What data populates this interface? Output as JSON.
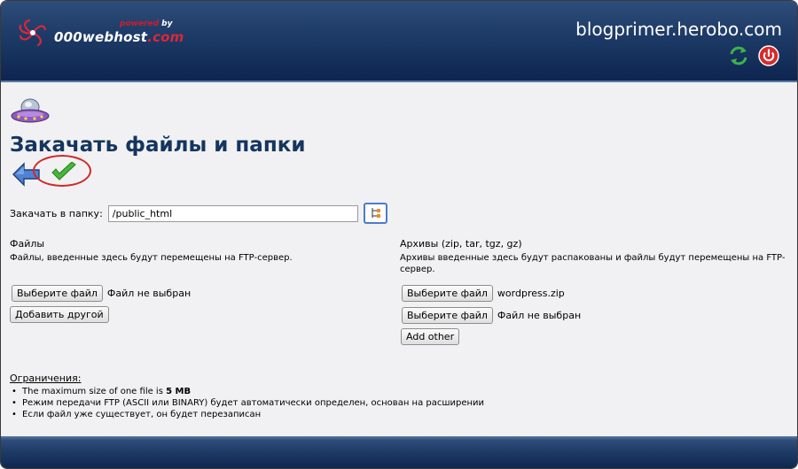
{
  "header": {
    "logo": {
      "powered": "powered",
      "by": "by",
      "name_main": "000webhost",
      "name_dot": ".com"
    },
    "site_title": "blogprimer.herobo.com",
    "icons": [
      {
        "name": "refresh-icon",
        "color": "#3db34a"
      },
      {
        "name": "power-icon",
        "color": "#d82b2b"
      }
    ]
  },
  "page": {
    "icon": "ufo-icon",
    "title": "Закачать файлы и папки",
    "nav": {
      "back_icon": "back-arrow-icon",
      "confirm_icon": "checkmark-icon"
    }
  },
  "folder": {
    "label": "Закачать в папку:",
    "value": "/public_html",
    "browse_icon": "folder-tree-icon"
  },
  "files": {
    "title": "Файлы",
    "description": "Файлы, введенные здесь будут перемещены на FTP-сервер.",
    "rows": [
      {
        "button": "Выберите файл",
        "status": "Файл не выбран"
      }
    ],
    "add_button": "Добавить другой"
  },
  "archives": {
    "title": "Архивы (zip, tar, tgz, gz)",
    "description": "Архивы введенные здесь будут распакованы и файлы будут перемещены на FTP-сервер.",
    "rows": [
      {
        "button": "Выберите файл",
        "status": "wordpress.zip"
      },
      {
        "button": "Выберите файл",
        "status": "Файл не выбран"
      }
    ],
    "add_button": "Add other"
  },
  "limits": {
    "title": "Ограничения:",
    "item1_prefix": "The maximum size of one file is ",
    "item1_value": "5 MB",
    "item2": "Режим передачи FTP (ASCII или BINARY) будет автоматически определен, основан на расширении",
    "item3": "Если файл уже существует, он будет перезаписан"
  },
  "colors": {
    "header_dark": "#0d2650",
    "title": "#14355e",
    "accent_red": "#d0282a",
    "check_green": "#45b839"
  }
}
